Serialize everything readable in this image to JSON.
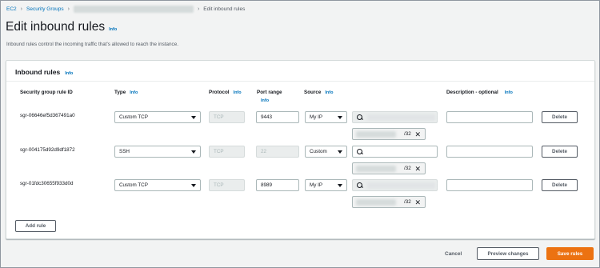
{
  "breadcrumb": {
    "items": [
      "EC2",
      "Security Groups"
    ],
    "current": "Edit inbound rules"
  },
  "page": {
    "title": "Edit inbound rules",
    "info": "Info",
    "description": "Inbound rules control the incoming traffic that's allowed to reach the instance."
  },
  "panel": {
    "title": "Inbound rules",
    "info": "Info",
    "columns": {
      "rule_id": "Security group rule ID",
      "type": "Type",
      "protocol": "Protocol",
      "port_range": "Port range",
      "source": "Source",
      "description": "Description - optional",
      "info": "Info"
    },
    "rules": [
      {
        "id": "sgr-06646ef5d367491a0",
        "type": "Custom TCP",
        "protocol": "TCP",
        "port": "9443",
        "source": "My IP",
        "cidr_suffix": "/32",
        "delete": "Delete"
      },
      {
        "id": "sgr-004175d92d9df1872",
        "type": "SSH",
        "protocol": "TCP",
        "port": "22",
        "source": "Custom",
        "cidr_suffix": "/32",
        "delete": "Delete"
      },
      {
        "id": "sgr-01fdc30655f933d0d",
        "type": "Custom TCP",
        "protocol": "TCP",
        "port": "8989",
        "source": "My IP",
        "cidr_suffix": "/32",
        "delete": "Delete"
      }
    ],
    "add_rule": "Add rule"
  },
  "footer": {
    "cancel": "Cancel",
    "preview": "Preview changes",
    "save": "Save rules"
  },
  "colors": {
    "link": "#0073bb",
    "primary": "#ec7211",
    "background": "#f2f3f3"
  }
}
